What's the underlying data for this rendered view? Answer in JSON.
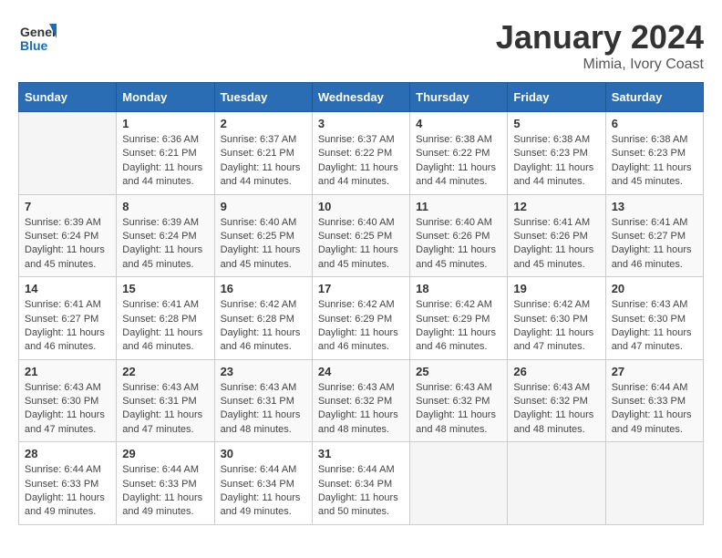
{
  "logo": {
    "line1": "General",
    "line2": "Blue"
  },
  "title": "January 2024",
  "location": "Mimia, Ivory Coast",
  "weekdays": [
    "Sunday",
    "Monday",
    "Tuesday",
    "Wednesday",
    "Thursday",
    "Friday",
    "Saturday"
  ],
  "weeks": [
    [
      {
        "day": "",
        "sunrise": "",
        "sunset": "",
        "daylight": ""
      },
      {
        "day": "1",
        "sunrise": "Sunrise: 6:36 AM",
        "sunset": "Sunset: 6:21 PM",
        "daylight": "Daylight: 11 hours and 44 minutes."
      },
      {
        "day": "2",
        "sunrise": "Sunrise: 6:37 AM",
        "sunset": "Sunset: 6:21 PM",
        "daylight": "Daylight: 11 hours and 44 minutes."
      },
      {
        "day": "3",
        "sunrise": "Sunrise: 6:37 AM",
        "sunset": "Sunset: 6:22 PM",
        "daylight": "Daylight: 11 hours and 44 minutes."
      },
      {
        "day": "4",
        "sunrise": "Sunrise: 6:38 AM",
        "sunset": "Sunset: 6:22 PM",
        "daylight": "Daylight: 11 hours and 44 minutes."
      },
      {
        "day": "5",
        "sunrise": "Sunrise: 6:38 AM",
        "sunset": "Sunset: 6:23 PM",
        "daylight": "Daylight: 11 hours and 44 minutes."
      },
      {
        "day": "6",
        "sunrise": "Sunrise: 6:38 AM",
        "sunset": "Sunset: 6:23 PM",
        "daylight": "Daylight: 11 hours and 45 minutes."
      }
    ],
    [
      {
        "day": "7",
        "sunrise": "Sunrise: 6:39 AM",
        "sunset": "Sunset: 6:24 PM",
        "daylight": "Daylight: 11 hours and 45 minutes."
      },
      {
        "day": "8",
        "sunrise": "Sunrise: 6:39 AM",
        "sunset": "Sunset: 6:24 PM",
        "daylight": "Daylight: 11 hours and 45 minutes."
      },
      {
        "day": "9",
        "sunrise": "Sunrise: 6:40 AM",
        "sunset": "Sunset: 6:25 PM",
        "daylight": "Daylight: 11 hours and 45 minutes."
      },
      {
        "day": "10",
        "sunrise": "Sunrise: 6:40 AM",
        "sunset": "Sunset: 6:25 PM",
        "daylight": "Daylight: 11 hours and 45 minutes."
      },
      {
        "day": "11",
        "sunrise": "Sunrise: 6:40 AM",
        "sunset": "Sunset: 6:26 PM",
        "daylight": "Daylight: 11 hours and 45 minutes."
      },
      {
        "day": "12",
        "sunrise": "Sunrise: 6:41 AM",
        "sunset": "Sunset: 6:26 PM",
        "daylight": "Daylight: 11 hours and 45 minutes."
      },
      {
        "day": "13",
        "sunrise": "Sunrise: 6:41 AM",
        "sunset": "Sunset: 6:27 PM",
        "daylight": "Daylight: 11 hours and 46 minutes."
      }
    ],
    [
      {
        "day": "14",
        "sunrise": "Sunrise: 6:41 AM",
        "sunset": "Sunset: 6:27 PM",
        "daylight": "Daylight: 11 hours and 46 minutes."
      },
      {
        "day": "15",
        "sunrise": "Sunrise: 6:41 AM",
        "sunset": "Sunset: 6:28 PM",
        "daylight": "Daylight: 11 hours and 46 minutes."
      },
      {
        "day": "16",
        "sunrise": "Sunrise: 6:42 AM",
        "sunset": "Sunset: 6:28 PM",
        "daylight": "Daylight: 11 hours and 46 minutes."
      },
      {
        "day": "17",
        "sunrise": "Sunrise: 6:42 AM",
        "sunset": "Sunset: 6:29 PM",
        "daylight": "Daylight: 11 hours and 46 minutes."
      },
      {
        "day": "18",
        "sunrise": "Sunrise: 6:42 AM",
        "sunset": "Sunset: 6:29 PM",
        "daylight": "Daylight: 11 hours and 46 minutes."
      },
      {
        "day": "19",
        "sunrise": "Sunrise: 6:42 AM",
        "sunset": "Sunset: 6:30 PM",
        "daylight": "Daylight: 11 hours and 47 minutes."
      },
      {
        "day": "20",
        "sunrise": "Sunrise: 6:43 AM",
        "sunset": "Sunset: 6:30 PM",
        "daylight": "Daylight: 11 hours and 47 minutes."
      }
    ],
    [
      {
        "day": "21",
        "sunrise": "Sunrise: 6:43 AM",
        "sunset": "Sunset: 6:30 PM",
        "daylight": "Daylight: 11 hours and 47 minutes."
      },
      {
        "day": "22",
        "sunrise": "Sunrise: 6:43 AM",
        "sunset": "Sunset: 6:31 PM",
        "daylight": "Daylight: 11 hours and 47 minutes."
      },
      {
        "day": "23",
        "sunrise": "Sunrise: 6:43 AM",
        "sunset": "Sunset: 6:31 PM",
        "daylight": "Daylight: 11 hours and 48 minutes."
      },
      {
        "day": "24",
        "sunrise": "Sunrise: 6:43 AM",
        "sunset": "Sunset: 6:32 PM",
        "daylight": "Daylight: 11 hours and 48 minutes."
      },
      {
        "day": "25",
        "sunrise": "Sunrise: 6:43 AM",
        "sunset": "Sunset: 6:32 PM",
        "daylight": "Daylight: 11 hours and 48 minutes."
      },
      {
        "day": "26",
        "sunrise": "Sunrise: 6:43 AM",
        "sunset": "Sunset: 6:32 PM",
        "daylight": "Daylight: 11 hours and 48 minutes."
      },
      {
        "day": "27",
        "sunrise": "Sunrise: 6:44 AM",
        "sunset": "Sunset: 6:33 PM",
        "daylight": "Daylight: 11 hours and 49 minutes."
      }
    ],
    [
      {
        "day": "28",
        "sunrise": "Sunrise: 6:44 AM",
        "sunset": "Sunset: 6:33 PM",
        "daylight": "Daylight: 11 hours and 49 minutes."
      },
      {
        "day": "29",
        "sunrise": "Sunrise: 6:44 AM",
        "sunset": "Sunset: 6:33 PM",
        "daylight": "Daylight: 11 hours and 49 minutes."
      },
      {
        "day": "30",
        "sunrise": "Sunrise: 6:44 AM",
        "sunset": "Sunset: 6:34 PM",
        "daylight": "Daylight: 11 hours and 49 minutes."
      },
      {
        "day": "31",
        "sunrise": "Sunrise: 6:44 AM",
        "sunset": "Sunset: 6:34 PM",
        "daylight": "Daylight: 11 hours and 50 minutes."
      },
      {
        "day": "",
        "sunrise": "",
        "sunset": "",
        "daylight": ""
      },
      {
        "day": "",
        "sunrise": "",
        "sunset": "",
        "daylight": ""
      },
      {
        "day": "",
        "sunrise": "",
        "sunset": "",
        "daylight": ""
      }
    ]
  ]
}
